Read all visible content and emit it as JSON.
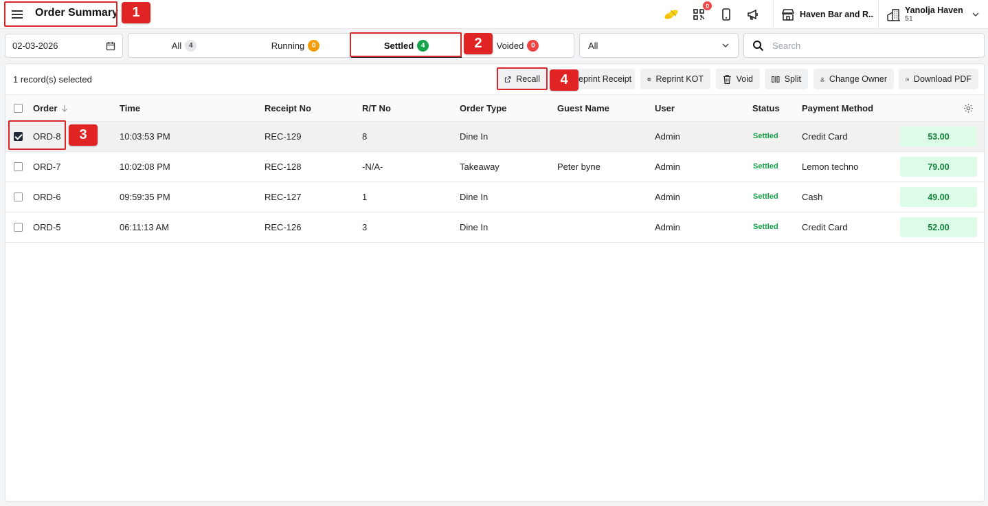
{
  "header": {
    "title": "Order Summary",
    "notification_count": "0",
    "outlet_name": "Haven Bar and R...",
    "company_name": "Yanolja Haven",
    "company_sub": "51"
  },
  "callouts": [
    "1",
    "2",
    "3",
    "4"
  ],
  "filters": {
    "date": "02-03-2026",
    "tabs": [
      {
        "label": "All",
        "count": "4"
      },
      {
        "label": "Running",
        "count": "0"
      },
      {
        "label": "Settled",
        "count": "4"
      },
      {
        "label": "Voided",
        "count": "0"
      }
    ],
    "active_tab": "Settled",
    "select_value": "All",
    "search_placeholder": "Search"
  },
  "toolbar": {
    "selected_text": "1 record(s) selected",
    "recall": "Recall",
    "reprint_receipt": "Reprint Receipt",
    "reprint_kot": "Reprint KOT",
    "void": "Void",
    "split": "Split",
    "change_owner": "Change Owner",
    "download_pdf": "Download PDF"
  },
  "table": {
    "columns": [
      "Order",
      "Time",
      "Receipt No",
      "R/T No",
      "Order Type",
      "Guest Name",
      "User",
      "Status",
      "Payment Method"
    ],
    "rows": [
      {
        "order": "ORD-8",
        "time": "10:03:53 PM",
        "receipt": "REC-129",
        "rt": "8",
        "type": "Dine In",
        "guest": "",
        "user": "Admin",
        "status": "Settled",
        "payment": "Credit Card",
        "amount": "53.00",
        "selected": true
      },
      {
        "order": "ORD-7",
        "time": "10:02:08 PM",
        "receipt": "REC-128",
        "rt": "-N/A-",
        "type": "Takeaway",
        "guest": "Peter byne",
        "user": "Admin",
        "status": "Settled",
        "payment": "Lemon techno",
        "amount": "79.00",
        "selected": false
      },
      {
        "order": "ORD-6",
        "time": "09:59:35 PM",
        "receipt": "REC-127",
        "rt": "1",
        "type": "Dine In",
        "guest": "",
        "user": "Admin",
        "status": "Settled",
        "payment": "Cash",
        "amount": "49.00",
        "selected": false
      },
      {
        "order": "ORD-5",
        "time": "06:11:13 AM",
        "receipt": "REC-126",
        "rt": "3",
        "type": "Dine In",
        "guest": "",
        "user": "Admin",
        "status": "Settled",
        "payment": "Credit Card",
        "amount": "52.00",
        "selected": false
      }
    ]
  },
  "colors": {
    "highlight": "#d9262b",
    "status_green": "#16a34a",
    "amount_bg": "#dcfce7"
  }
}
